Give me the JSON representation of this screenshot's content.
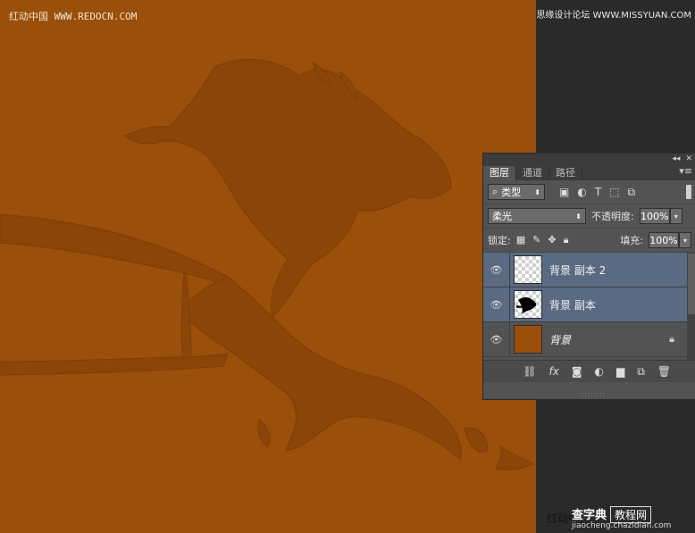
{
  "watermarks": {
    "top_left": "红动中国 WWW.REDOCN.COM",
    "top_right": "思缘设计论坛 WWW.MISSYUAN.COM",
    "bottom_left_text": "红动中",
    "bottom_logo_main": "查字典",
    "bottom_logo_box": "教程网",
    "bottom_logo_sub": "jiaocheng.chazidian.com"
  },
  "layers_panel": {
    "tabs": [
      "图层",
      "通道",
      "路径"
    ],
    "active_tab": 0,
    "filter_label": "类型",
    "blend_mode": "柔光",
    "opacity_label": "不透明度:",
    "opacity_value": "100%",
    "lock_label": "锁定:",
    "fill_label": "填充:",
    "fill_value": "100%",
    "layers": [
      {
        "name": "背景 副本 2",
        "selected": true
      },
      {
        "name": "背景 副本",
        "selected": true
      },
      {
        "name": "背景",
        "selected": false,
        "locked": true
      }
    ]
  },
  "colors": {
    "canvas": "#9a4f0b",
    "horse": "#8d4708",
    "panel_bg": "#535353",
    "selected_layer": "#596a82"
  }
}
